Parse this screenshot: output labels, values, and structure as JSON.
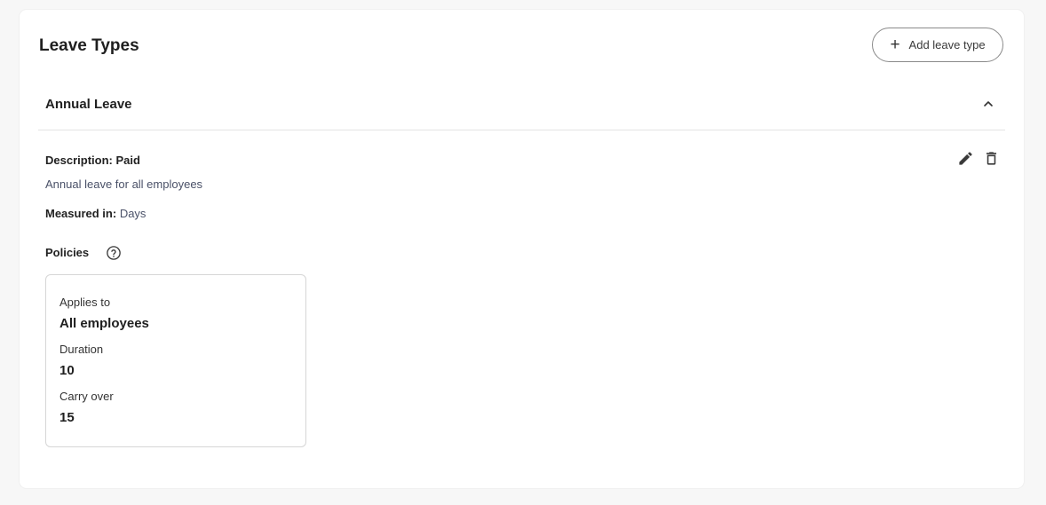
{
  "page": {
    "title": "Leave Types",
    "add_button_label": "Add leave type"
  },
  "leave_type": {
    "name": "Annual Leave",
    "description_label": "Description:",
    "description_value": "Paid",
    "description_text": "Annual leave for all employees",
    "measured_label": "Measured in:",
    "measured_value": "Days",
    "policies_label": "Policies",
    "policy": {
      "applies_to_label": "Applies to",
      "applies_to_value": "All employees",
      "duration_label": "Duration",
      "duration_value": "10",
      "carry_over_label": "Carry over",
      "carry_over_value": "15"
    }
  },
  "icons": {
    "add": "plus-icon",
    "expand": "chevron-up-icon",
    "edit": "pencil-icon",
    "delete": "trash-icon",
    "help": "question-circle-icon"
  }
}
